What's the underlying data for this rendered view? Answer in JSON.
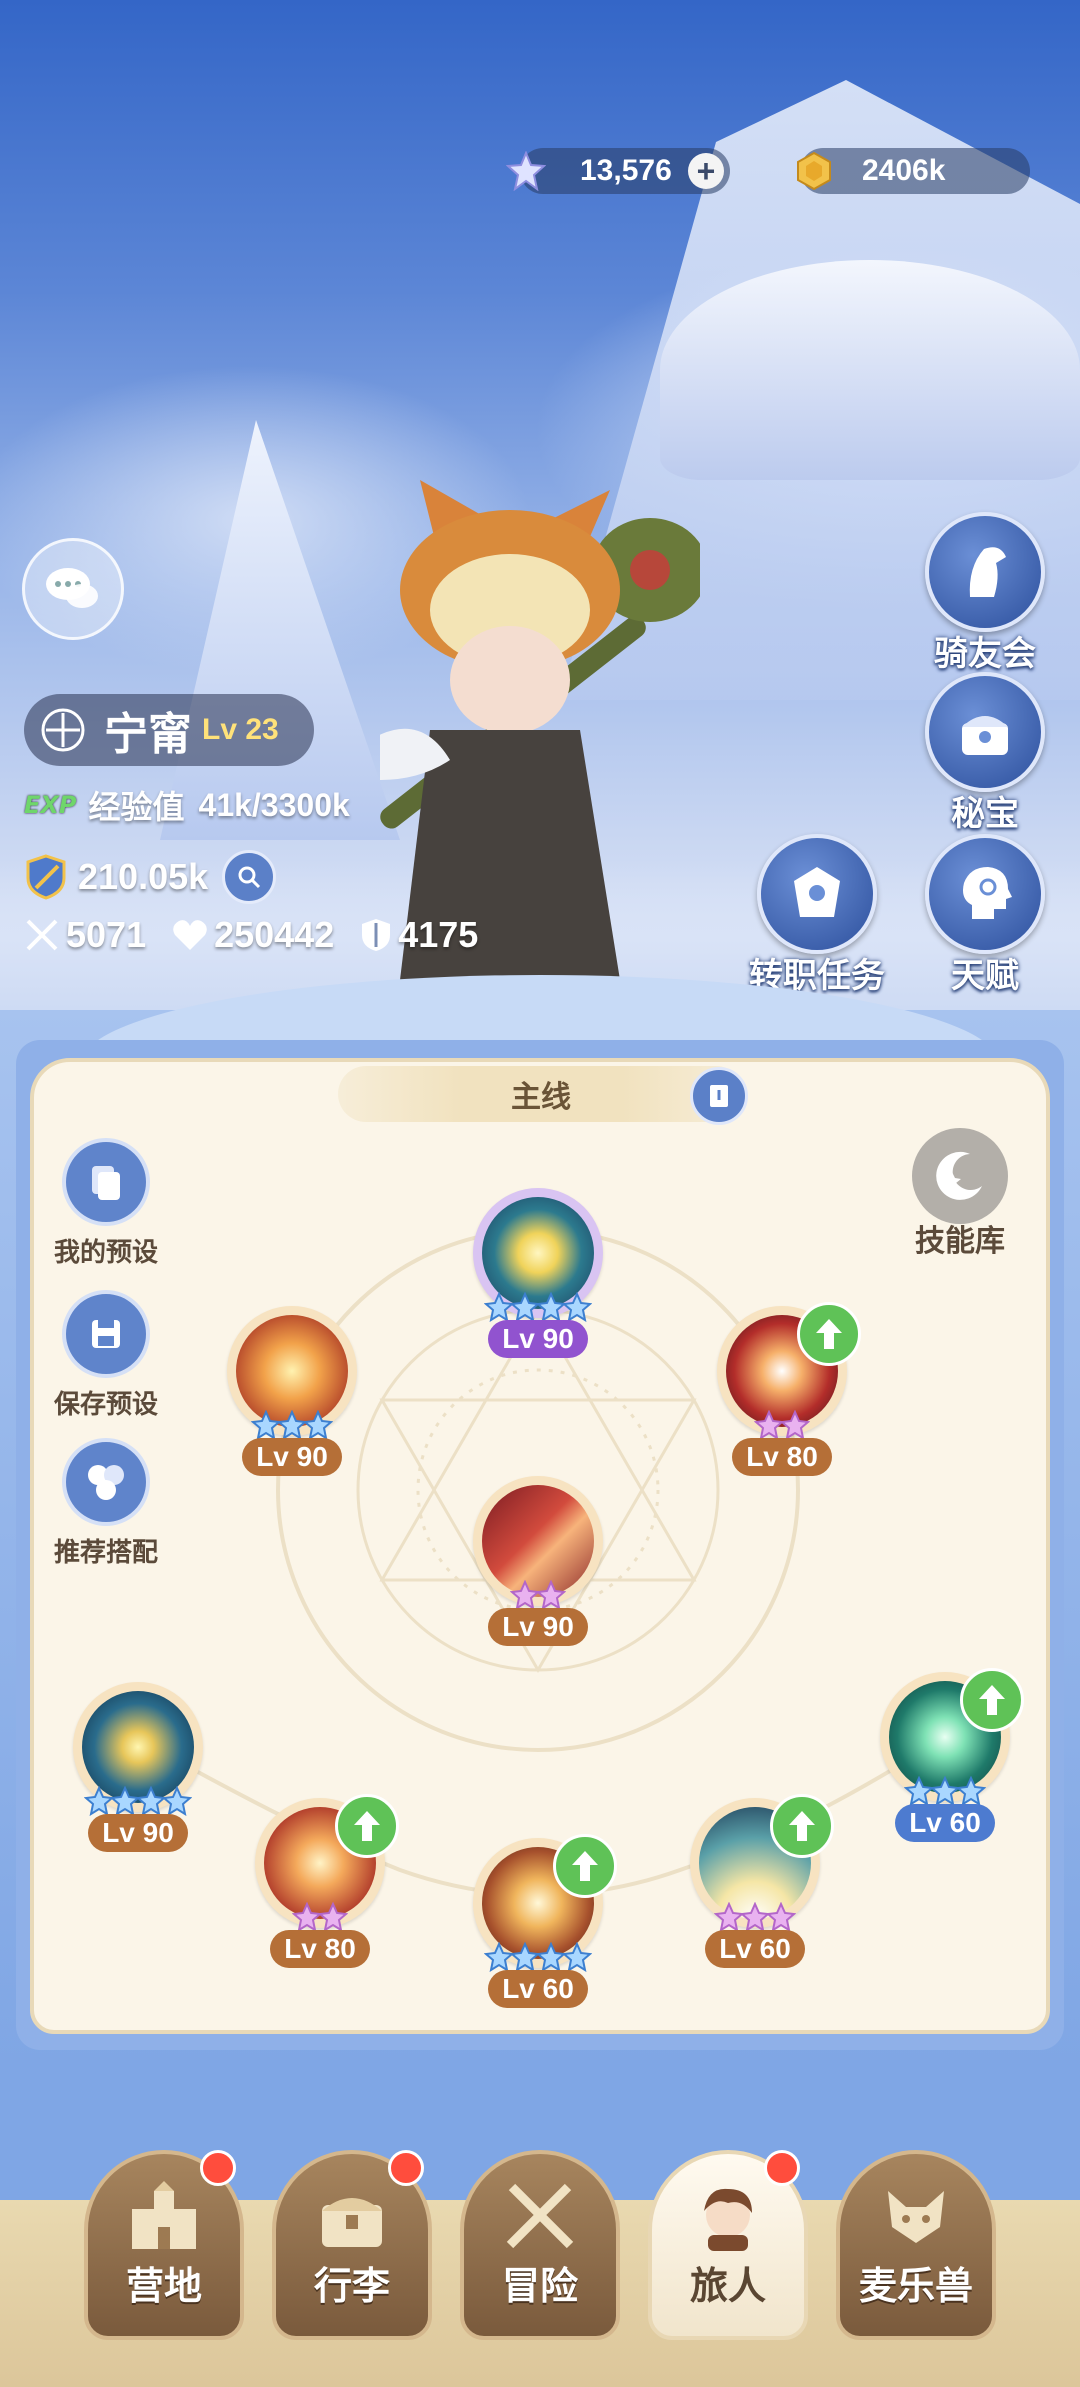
{
  "currency": {
    "crystal_amount": "13,576",
    "gold_amount": "2406k"
  },
  "player": {
    "name": "宁甯",
    "level": "Lv 23",
    "exp_badge": "EXP",
    "exp_label": "经验值",
    "exp_value": "41k/3300k",
    "power": "210.05k",
    "attack": "5071",
    "hp": "250442",
    "defense": "4175"
  },
  "side_buttons": {
    "riders": "骑友会",
    "treasure": "秘宝",
    "job_quest": "转职任务",
    "talent": "天赋"
  },
  "panel": {
    "title": "主线",
    "my_presets": "我的预设",
    "save_preset": "保存预设",
    "recommended": "推荐搭配",
    "skill_library": "技能库"
  },
  "skills": [
    {
      "level": "Lv 90",
      "stars": 4,
      "star_color": "blue",
      "upgrade": false,
      "tag": "purple"
    },
    {
      "level": "Lv 90",
      "stars": 3,
      "star_color": "blue",
      "upgrade": false,
      "tag": "orange"
    },
    {
      "level": "Lv 80",
      "stars": 2,
      "star_color": "pink",
      "upgrade": true,
      "tag": "orange"
    },
    {
      "level": "Lv 90",
      "stars": 2,
      "star_color": "pink",
      "upgrade": false,
      "tag": "orange"
    },
    {
      "level": "Lv 90",
      "stars": 4,
      "star_color": "blue",
      "upgrade": false,
      "tag": "orange"
    },
    {
      "level": "Lv 60",
      "stars": 3,
      "star_color": "blue",
      "upgrade": true,
      "tag": "blue"
    },
    {
      "level": "Lv 80",
      "stars": 2,
      "star_color": "pink",
      "upgrade": true,
      "tag": "orange"
    },
    {
      "level": "Lv 60",
      "stars": 4,
      "star_color": "blue",
      "upgrade": true,
      "tag": "orange"
    },
    {
      "level": "Lv 60",
      "stars": 3,
      "star_color": "pink",
      "upgrade": true,
      "tag": "orange"
    }
  ],
  "nav": {
    "camp": "营地",
    "bag": "行李",
    "adventure": "冒险",
    "traveler": "旅人",
    "pet": "麦乐兽",
    "active": "traveler",
    "badges": [
      "camp",
      "bag",
      "traveler"
    ]
  },
  "colors": {
    "accent_blue": "#5b80c8",
    "level_orange": "#b56f37",
    "level_purple": "#9153cf",
    "upgrade_green": "#5fc257",
    "panel_cream": "#fbf5e8"
  }
}
